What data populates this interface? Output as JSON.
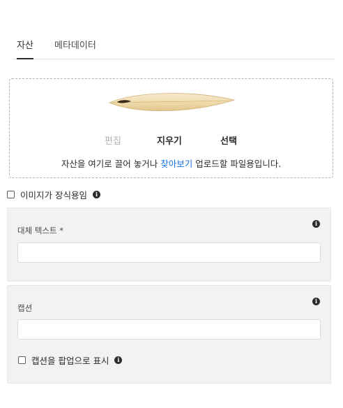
{
  "tabs": [
    {
      "label": "자산",
      "active": true
    },
    {
      "label": "메타데이터",
      "active": false
    }
  ],
  "dropzone": {
    "image": "surfboard",
    "actions": {
      "edit": "편집",
      "clear": "지우기",
      "select": "선택"
    },
    "text_before": "자산을 여기로 끌어 놓거나 ",
    "browse_link": "찾아보기",
    "text_after": " 업로드할 파일용입니다."
  },
  "decorative": {
    "label": "이미지가 장식용임",
    "checked": false
  },
  "alt_text": {
    "label": "대체 텍스트 *",
    "value": ""
  },
  "caption": {
    "label": "캡션",
    "value": "",
    "popup_label": "캡션을 팝업으로 표시",
    "popup_checked": false
  },
  "colors": {
    "accent": "#1473e6",
    "panel": "#f2f2f2",
    "text": "#2c2c2c"
  }
}
